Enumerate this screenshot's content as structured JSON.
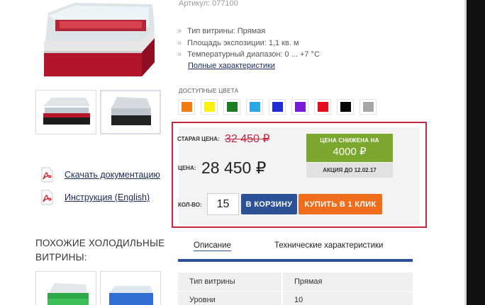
{
  "product": {
    "article": "Артикул: 077100",
    "specs": [
      "Тип витрины: Прямая",
      "Площадь экспозиции: 1,1 кв. м",
      "Температурный диапазон: 0 ... +7 °С"
    ],
    "full_specs_link": "Полные характеристики"
  },
  "colors": {
    "label": "ДОСТУПНЫЕ ЦВЕТА",
    "swatches": [
      "#f07d14",
      "#f7f20e",
      "#1e7d1f",
      "#29a8e6",
      "#1f2bd6",
      "#7a1bd9",
      "#e5101b",
      "#050505",
      "#a6a6a6"
    ]
  },
  "price": {
    "old_label": "СТАРАЯ ЦЕНА:",
    "old_value": "32 450 ₽",
    "new_label": "ЦЕНА:",
    "new_value": "28 450 ₽",
    "discount_title": "ЦЕНА СНИЖЕНА НА",
    "discount_amount": "4000 ₽",
    "promo": "АКЦИЯ ДО 12.02.17"
  },
  "cart": {
    "qty_label": "КОЛ-ВО:",
    "qty_value": "15",
    "add_to_cart": "В КОРЗИНУ",
    "buy_one_click": "КУПИТЬ В 1 КЛИК"
  },
  "docs": {
    "download": "Скачать документацию",
    "manual": "Инструкция (English)"
  },
  "similar": {
    "title": "ПОХОЖИЕ ХОЛОДИЛЬНЫЕ ВИТРИНЫ:"
  },
  "tabs": {
    "description": "Описание",
    "characteristics": "Технические характеристики"
  },
  "table": {
    "rows": [
      {
        "name": "Тип витрины",
        "value": "Прямая"
      },
      {
        "name": "Уровни",
        "value": "10"
      }
    ]
  },
  "accent_colors": {
    "border": "#c3273d",
    "discount": "#7ba72e",
    "cart": "#2d5196",
    "oneclick": "#ef6d1b"
  }
}
